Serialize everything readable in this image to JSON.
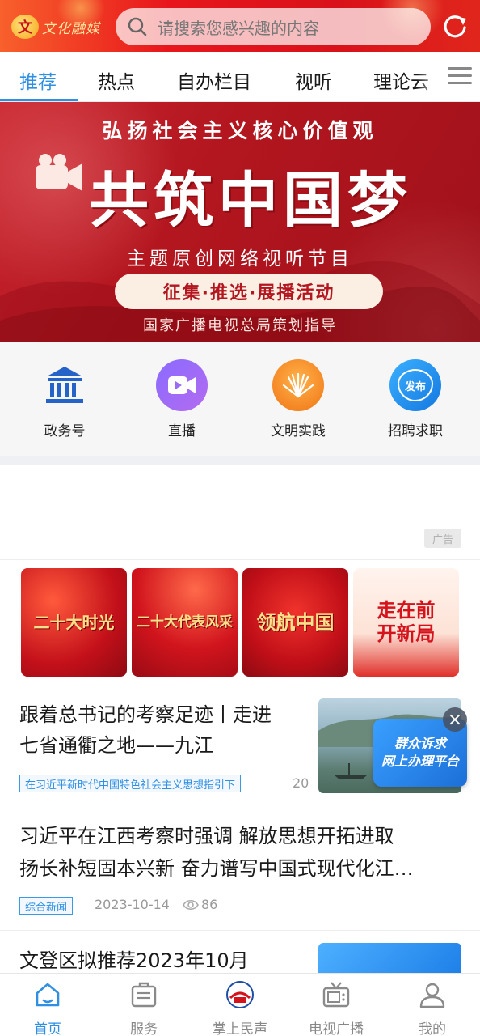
{
  "header": {
    "logo_text": "文化融媒",
    "search_placeholder": "请搜索您感兴趣的内容",
    "refresh_icon": "refresh-icon",
    "colors": {
      "header_start": "#f8602c",
      "header_end": "#d9111a"
    }
  },
  "tabs": [
    {
      "label": "推荐",
      "active": true
    },
    {
      "label": "热点"
    },
    {
      "label": "自办栏目"
    },
    {
      "label": "视听"
    },
    {
      "label": "理论云"
    }
  ],
  "banner": {
    "top_line": "弘扬社会主义核心价值观",
    "main_title": "共筑中国梦",
    "subtitle": "主题原创网络视听节目",
    "pill": "征集·推选·展播活动",
    "footer": "国家广播电视总局策划指导"
  },
  "quick_entries": [
    {
      "label": "政务号",
      "icon": "government-building-icon"
    },
    {
      "label": "直播",
      "icon": "live-video-icon"
    },
    {
      "label": "文明实践",
      "icon": "civilization-practice-icon"
    },
    {
      "label": "招聘求职",
      "icon": "recruitment-publish-icon",
      "badge": "发布"
    }
  ],
  "ad": {
    "badge": "广告"
  },
  "cards": [
    {
      "text": "二十大时光"
    },
    {
      "text": "二十大代表风采"
    },
    {
      "text": "领航中国"
    },
    {
      "text": "走在前 开新局"
    }
  ],
  "news": [
    {
      "title_line1": "跟着总书记的考察足迹丨走进",
      "title_line2": "七省通衢之地——九江",
      "tag": "在习近平新时代中国特色社会主义思想指引下",
      "date_partial": "20"
    },
    {
      "title_line1": "习近平在江西考察时强调 解放思想开拓进取",
      "title_line2": "扬长补短固本兴新 奋力谱写中国式现代化江…",
      "tag": "综合新闻",
      "date": "2023-10-14",
      "views": "86"
    },
    {
      "title_line1": "文登区拟推荐2023年10月"
    }
  ],
  "float_ad": {
    "line1": "群众诉求",
    "line2": "网上办理平台"
  },
  "bottom_nav": [
    {
      "label": "首页",
      "icon": "home-icon",
      "active": true
    },
    {
      "label": "服务",
      "icon": "service-icon"
    },
    {
      "label": "掌上民声",
      "icon": "people-voice-icon"
    },
    {
      "label": "电视广播",
      "icon": "tv-icon"
    },
    {
      "label": "我的",
      "icon": "profile-icon"
    }
  ],
  "colors": {
    "accent": "#2f8fe3",
    "banner_red": "#b3161f",
    "tag_blue": "#3a9ae8"
  }
}
